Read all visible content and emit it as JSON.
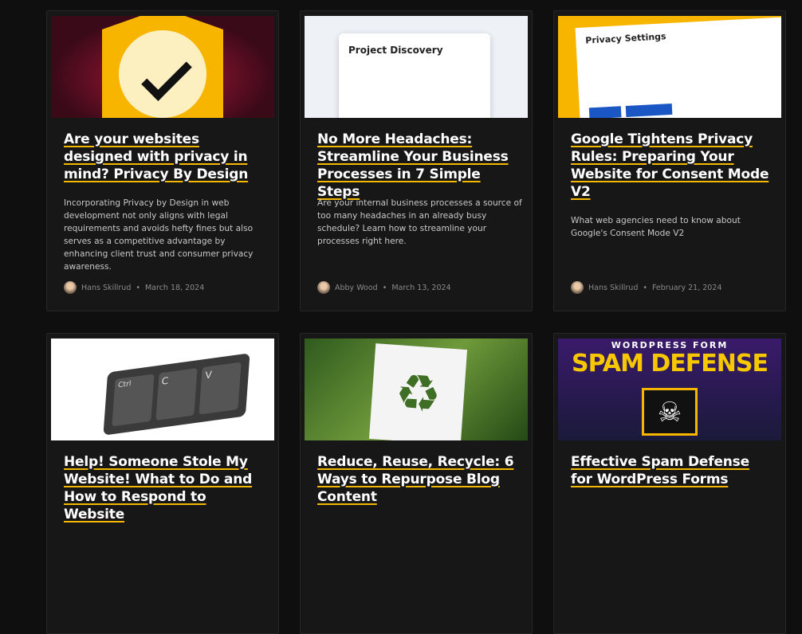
{
  "posts": [
    {
      "title": "Are your websites designed with privacy in mind? Privacy By Design",
      "excerpt": "Incorporating Privacy by Design in web development not only aligns with legal requirements and avoids hefty fines but also serves as a competitive advantage by enhancing client trust and consumer privacy awareness.",
      "author": "Hans Skillrud",
      "date": "March 18, 2024",
      "image": "shield-checkmark"
    },
    {
      "title": "No More Headaches: Streamline Your Business Processes in 7 Simple Steps",
      "excerpt": "Are your internal business processes a source of too many headaches in an already busy schedule? Learn how to streamline your processes right here.",
      "author": "Abby Wood",
      "date": "March 13, 2024",
      "image": "project-discovery-flowchart",
      "image_text": "Project Discovery"
    },
    {
      "title": "Google Tightens Privacy Rules: Preparing Your Website for Consent Mode V2",
      "excerpt": "What web agencies need to know about Google's Consent Mode V2",
      "author": "Hans Skillrud",
      "date": "February 21, 2024",
      "image": "privacy-settings-dialog",
      "image_text": "Privacy Settings"
    },
    {
      "title": "Help! Someone Stole My Website! What to Do and How to Respond to Website",
      "author": "",
      "date": "",
      "image": "ctrl-c-v-keyboard",
      "keys": [
        "Ctrl",
        "C",
        "V"
      ]
    },
    {
      "title": "Reduce, Reuse, Recycle: 6 Ways to Repurpose Blog Content",
      "image": "recycle-symbol-paper"
    },
    {
      "title": "Effective Spam Defense for WordPress Forms",
      "image": "spam-defense-banner",
      "image_text": [
        "WORDPRESS FORM",
        "SPAM DEFENSE"
      ]
    }
  ],
  "separator": "•",
  "colors": {
    "accent": "#f5b800",
    "background": "#0f0f0f",
    "card": "#171717"
  }
}
